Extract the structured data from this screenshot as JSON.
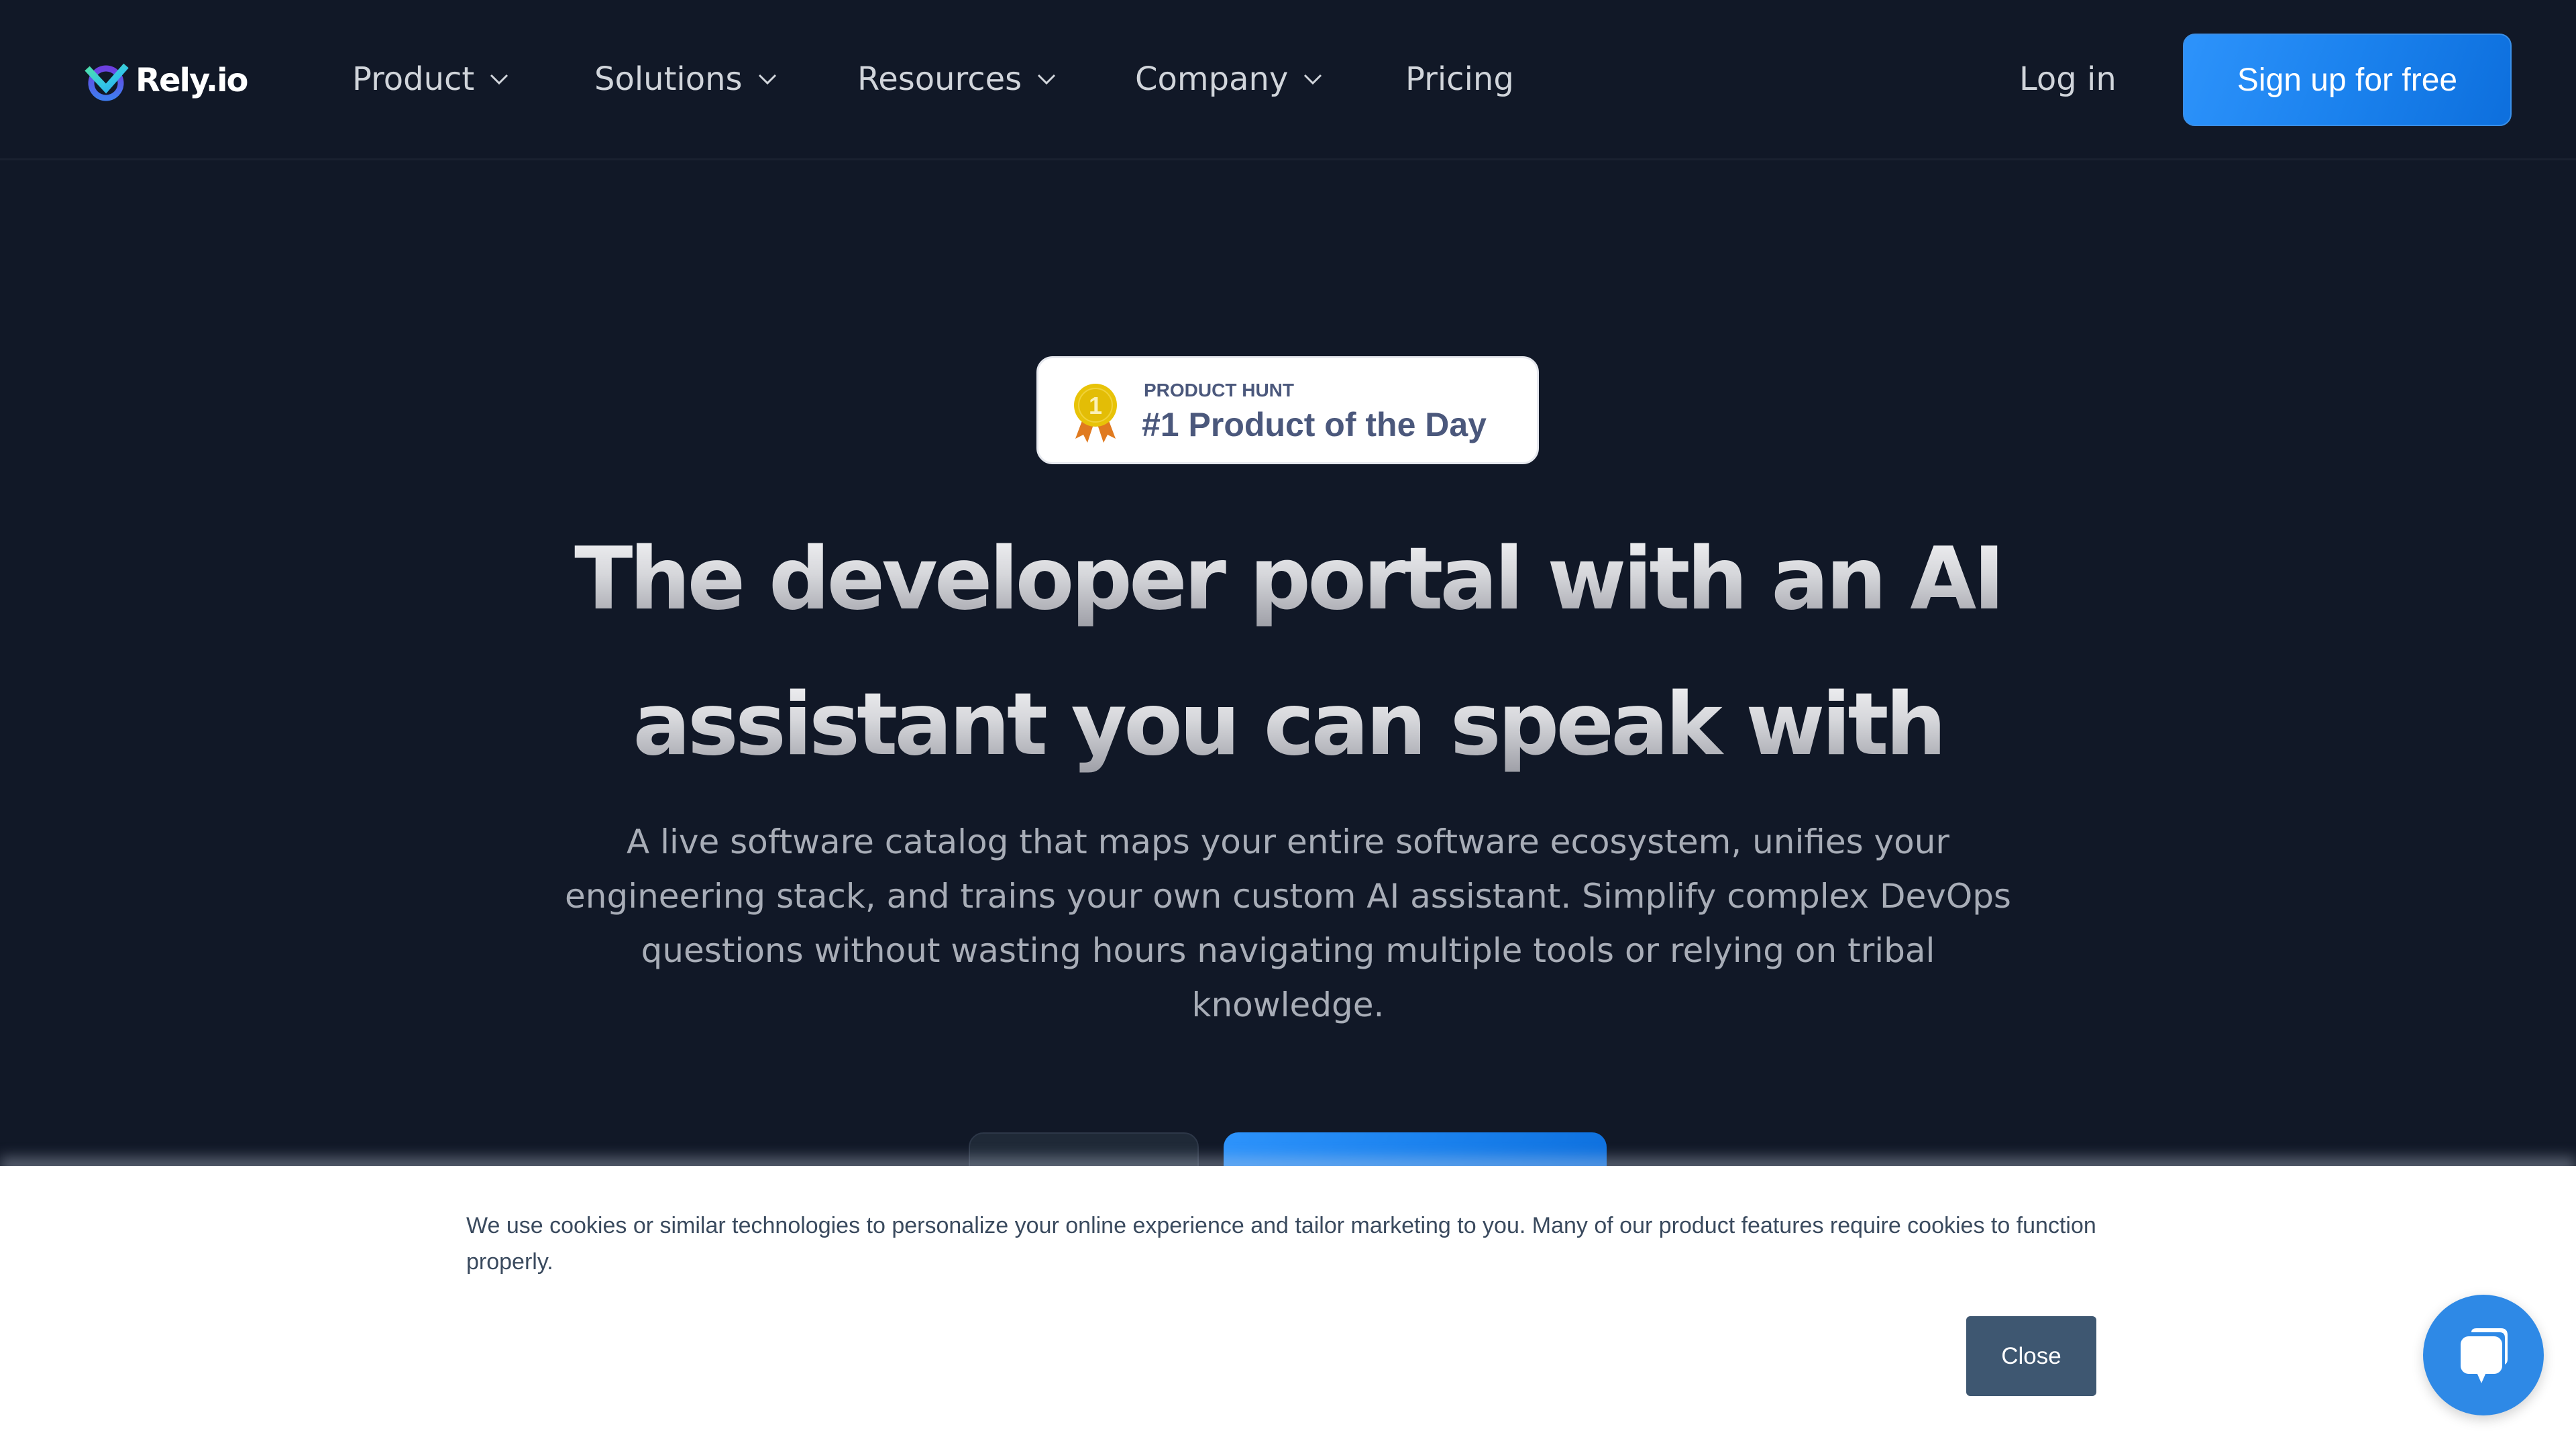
{
  "brand": {
    "name": "Rely.io",
    "colors": {
      "background": "#111827",
      "primary": "#1b82ee",
      "badge_text": "#4b587c",
      "cookie_close": "#3e5771",
      "chat_launcher": "#2e89e6"
    }
  },
  "nav": {
    "items": [
      {
        "label": "Product",
        "has_dropdown": true,
        "icon": "chevron-down-icon"
      },
      {
        "label": "Solutions",
        "has_dropdown": true,
        "icon": "chevron-down-icon"
      },
      {
        "label": "Resources",
        "has_dropdown": true,
        "icon": "chevron-down-icon"
      },
      {
        "label": "Company",
        "has_dropdown": true,
        "icon": "chevron-down-icon"
      },
      {
        "label": "Pricing",
        "has_dropdown": false
      }
    ],
    "login_label": "Log in",
    "signup_label": "Sign up for free"
  },
  "hero": {
    "badge": {
      "kicker": "PRODUCT HUNT",
      "title": "#1 Product of the Day",
      "icon": "medal-icon",
      "medal_number": "1"
    },
    "headline_line1": "The developer portal with an AI",
    "headline_line2": "assistant you can speak with",
    "subtitle": "A live software catalog that maps your entire software ecosystem, unifies your engineering stack, and trains your own custom AI assistant. Simplify complex DevOps questions without wasting hours navigating multiple tools or relying on tribal knowledge."
  },
  "cookie_banner": {
    "text": "We use cookies or similar technologies to personalize your online experience and tailor marketing to you. Many of our product features require cookies to function properly.",
    "close_label": "Close"
  },
  "chat_widget": {
    "icon": "chat-bubble-icon"
  }
}
